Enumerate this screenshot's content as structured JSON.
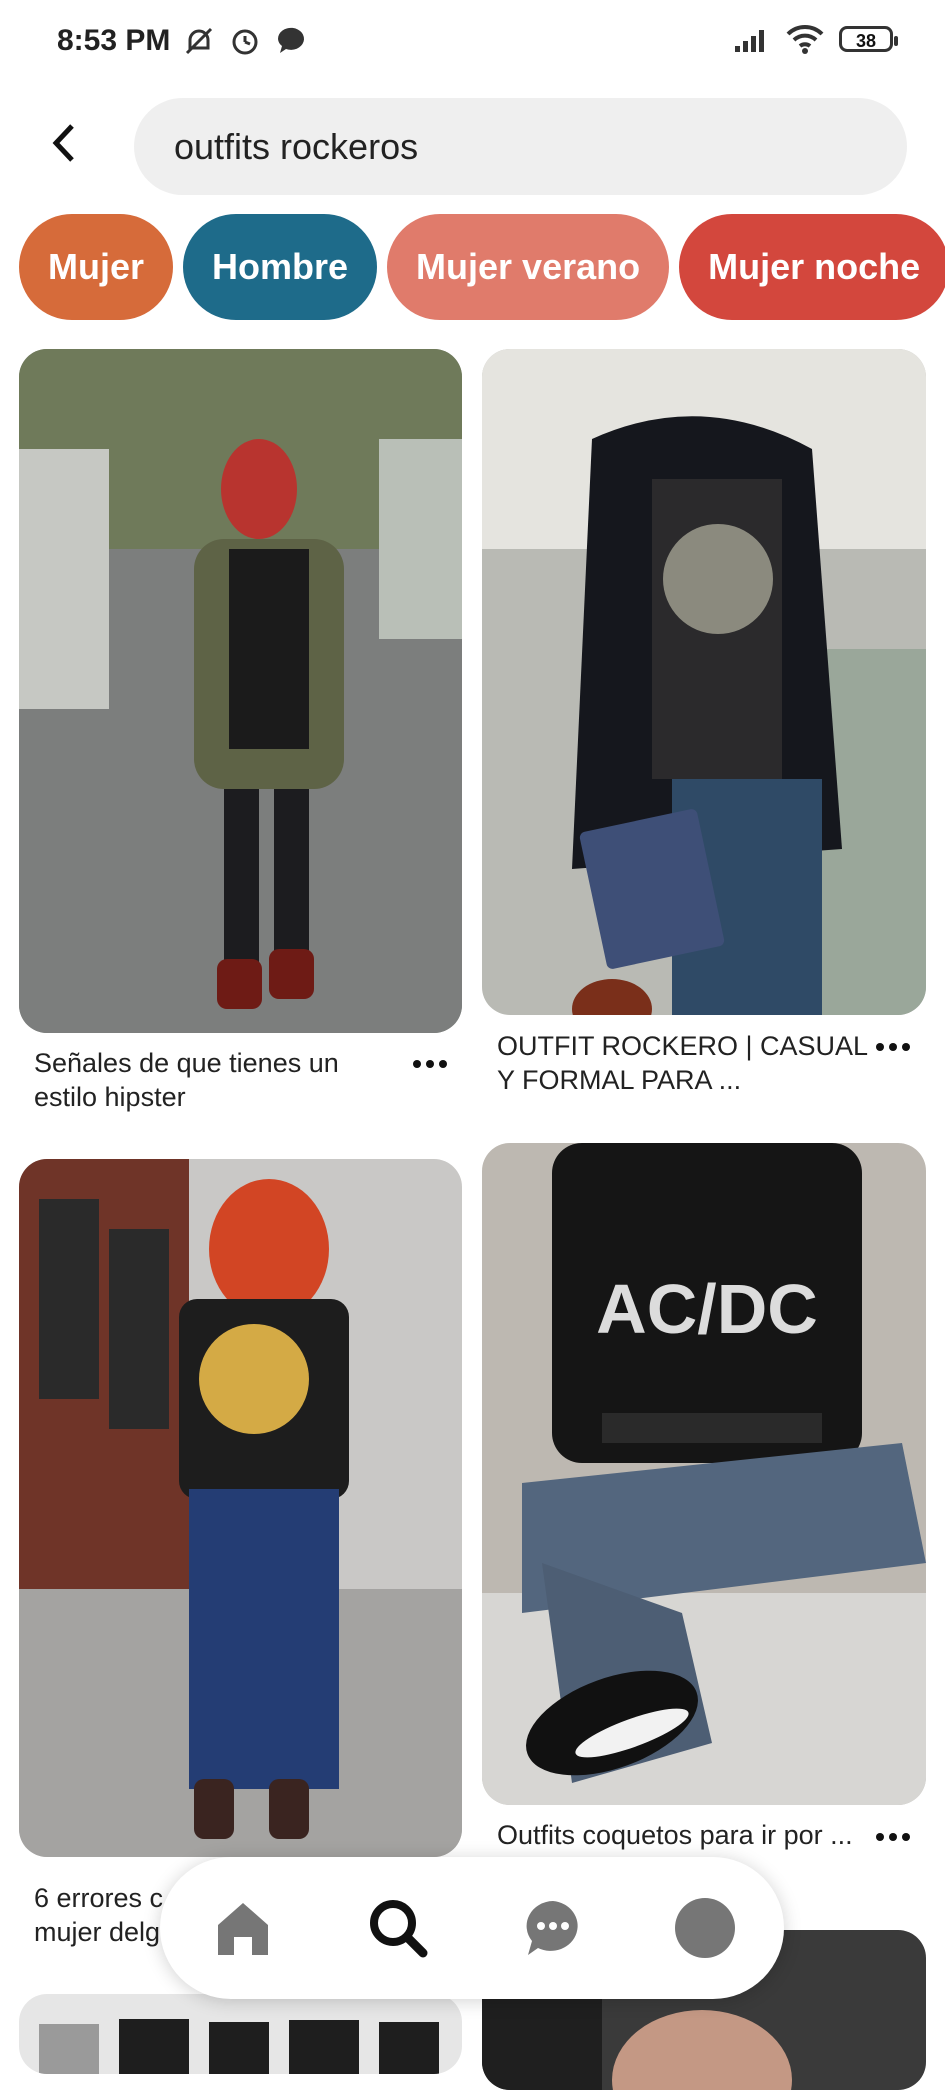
{
  "status_bar": {
    "time": "8:53 PM",
    "battery": "38",
    "icons": [
      "mute-icon",
      "alarm-icon",
      "chat-bubble-icon",
      "signal-icon",
      "wifi-icon",
      "battery-icon"
    ]
  },
  "search": {
    "query": "outfits rockeros",
    "back_icon": "chevron-left-icon"
  },
  "chips": [
    {
      "label": "Mujer",
      "color": "#D66B3A"
    },
    {
      "label": "Hombre",
      "color": "#1E6B8A"
    },
    {
      "label": "Mujer verano",
      "color": "#E07B6B"
    },
    {
      "label": "Mujer noche",
      "color": "#D3473D"
    }
  ],
  "pins": [
    {
      "caption": "Señales de que tienes un estilo hipster"
    },
    {
      "caption": "OUTFIT ROCKERO | CASUAL Y FORMAL PARA ..."
    },
    {
      "caption": "6 errores c... mujer delg..."
    },
    {
      "caption": "Outfits coquetos para ir por ... amigas"
    }
  ],
  "nav": {
    "items": [
      "home-icon",
      "search-icon",
      "messages-icon",
      "profile-icon"
    ]
  }
}
